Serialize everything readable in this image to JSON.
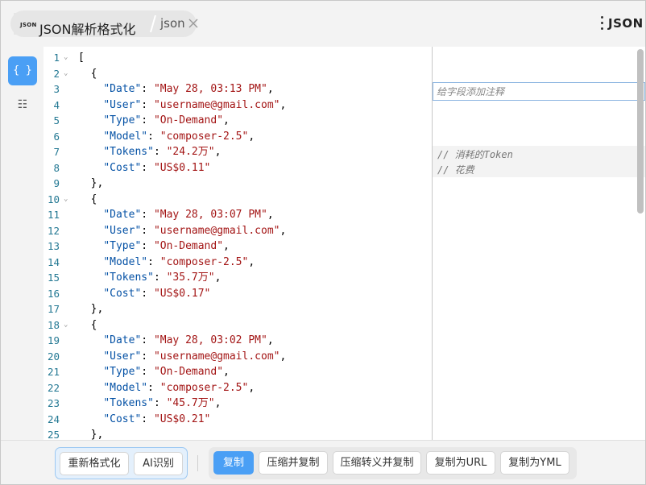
{
  "header": {
    "tab_badge": "JSON",
    "tab_title": "JSON解析格式化",
    "tab_second": "json",
    "brand": "JSON"
  },
  "sidebar": {
    "items": [
      {
        "icon": "braces-icon",
        "glyph": "{ }",
        "active": true
      },
      {
        "icon": "list-icon",
        "glyph": "☷",
        "active": false
      }
    ]
  },
  "editor": {
    "lines": [
      {
        "n": "1",
        "fold": true,
        "text": "["
      },
      {
        "n": "2",
        "fold": true,
        "text": "  {"
      },
      {
        "n": "3",
        "key": "Date",
        "val": "May 28, 03:13 PM",
        "comma": true
      },
      {
        "n": "4",
        "key": "User",
        "val": "username@gmail.com",
        "comma": true
      },
      {
        "n": "5",
        "key": "Type",
        "val": "On-Demand",
        "comma": true
      },
      {
        "n": "6",
        "key": "Model",
        "val": "composer-2.5",
        "comma": true
      },
      {
        "n": "7",
        "key": "Tokens",
        "val": "24.2万",
        "comma": true
      },
      {
        "n": "8",
        "key": "Cost",
        "val": "US$0.11",
        "comma": false
      },
      {
        "n": "9",
        "text": "  },"
      },
      {
        "n": "10",
        "fold": true,
        "text": "  {"
      },
      {
        "n": "11",
        "key": "Date",
        "val": "May 28, 03:07 PM",
        "comma": true
      },
      {
        "n": "12",
        "key": "User",
        "val": "username@gmail.com",
        "comma": true
      },
      {
        "n": "13",
        "key": "Type",
        "val": "On-Demand",
        "comma": true
      },
      {
        "n": "14",
        "key": "Model",
        "val": "composer-2.5",
        "comma": true
      },
      {
        "n": "15",
        "key": "Tokens",
        "val": "35.7万",
        "comma": true
      },
      {
        "n": "16",
        "key": "Cost",
        "val": "US$0.17",
        "comma": false
      },
      {
        "n": "17",
        "text": "  },"
      },
      {
        "n": "18",
        "fold": true,
        "text": "  {"
      },
      {
        "n": "19",
        "key": "Date",
        "val": "May 28, 03:02 PM",
        "comma": true
      },
      {
        "n": "20",
        "key": "User",
        "val": "username@gmail.com",
        "comma": true
      },
      {
        "n": "21",
        "key": "Type",
        "val": "On-Demand",
        "comma": true
      },
      {
        "n": "22",
        "key": "Model",
        "val": "composer-2.5",
        "comma": true
      },
      {
        "n": "23",
        "key": "Tokens",
        "val": "45.7万",
        "comma": true
      },
      {
        "n": "24",
        "key": "Cost",
        "val": "US$0.21",
        "comma": false
      },
      {
        "n": "25",
        "text": "  },"
      }
    ]
  },
  "annotations": {
    "input_placeholder": "给字段添加注释",
    "comments": [
      "// 消耗的Token",
      "// 花费"
    ]
  },
  "toolbar": {
    "reformat": "重新格式化",
    "ai_recognize": "AI识别",
    "copy": "复制",
    "compress_copy": "压缩并复制",
    "compress_escape_copy": "压缩转义并复制",
    "copy_as_url": "复制为URL",
    "copy_as_yml": "复制为YML"
  },
  "colors": {
    "accent": "#4a9ff5",
    "key": "#0451a5",
    "string": "#a31515",
    "line_number": "#237893"
  }
}
